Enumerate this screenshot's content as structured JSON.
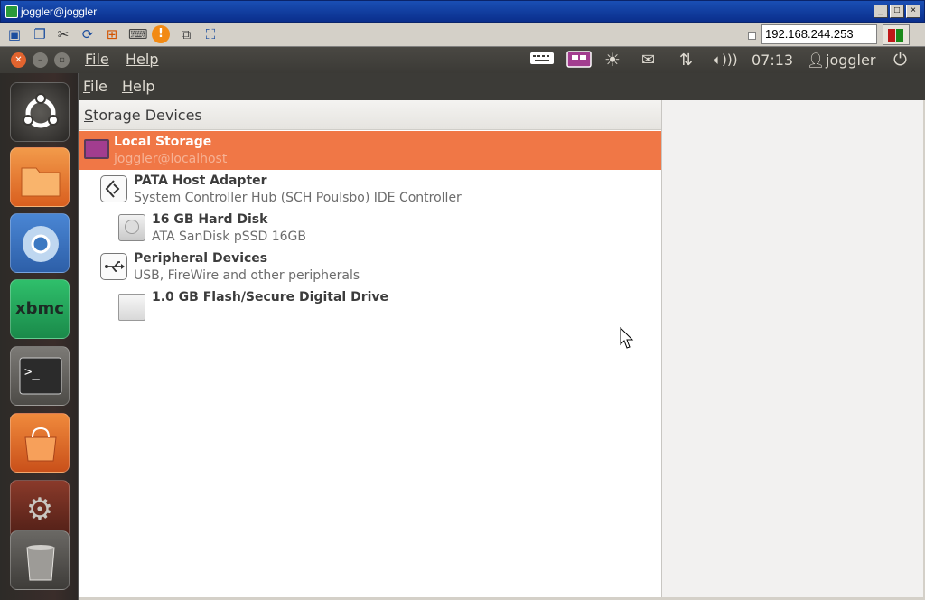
{
  "vnc": {
    "title": "joggler@joggler",
    "window_buttons": [
      "_",
      "□",
      "×"
    ],
    "toolbar_icons": [
      "monitor-icon",
      "copy-icon",
      "tools-icon",
      "refresh-icon",
      "windows-icon",
      "keyboard-icon",
      "alert-icon",
      "disconnect-icon",
      "fullscreen-icon"
    ],
    "ip_address": "192.168.244.253",
    "status_colors": [
      "#c01818",
      "#1a8a1a"
    ]
  },
  "top_panel": {
    "menus": [
      "File",
      "Help"
    ],
    "time": "07:13",
    "user": "joggler",
    "indicators": [
      "keyboard-icon",
      "display-icon",
      "brightness-icon",
      "mail-icon",
      "network-icon",
      "volume-icon"
    ],
    "accent": "#e2642f"
  },
  "app_menu": {
    "items": [
      {
        "letter": "F",
        "rest": "ile"
      },
      {
        "letter": "H",
        "rest": "elp"
      }
    ]
  },
  "launcher": {
    "items": [
      "ubuntu-logo-icon",
      "files-icon",
      "chromium-icon",
      "xbmc-icon",
      "terminal-icon",
      "software-center-icon",
      "settings-icon",
      "trash-icon"
    ],
    "xbmc_label": "xbmc"
  },
  "storage": {
    "header": {
      "letter": "S",
      "rest": "torage Devices"
    },
    "devices": [
      {
        "title": "Local Storage",
        "subtitle": "joggler@localhost",
        "icon": "computer-icon",
        "selected": true,
        "indent": 0
      },
      {
        "title": "PATA Host Adapter",
        "subtitle": "System Controller Hub (SCH Poulsbo) IDE Controller",
        "icon": "controller-icon",
        "selected": false,
        "indent": 1
      },
      {
        "title": "16 GB Hard Disk",
        "subtitle": "ATA SanDisk pSSD 16GB",
        "icon": "hard-disk-icon",
        "selected": false,
        "indent": 2
      },
      {
        "title": "Peripheral Devices",
        "subtitle": "USB, FireWire and other peripherals",
        "icon": "usb-icon",
        "selected": false,
        "indent": 1
      },
      {
        "title": "1.0 GB Flash/Secure Digital Drive",
        "subtitle": "",
        "icon": "flash-drive-icon",
        "selected": false,
        "indent": 2
      }
    ],
    "accent": "#f07746"
  }
}
